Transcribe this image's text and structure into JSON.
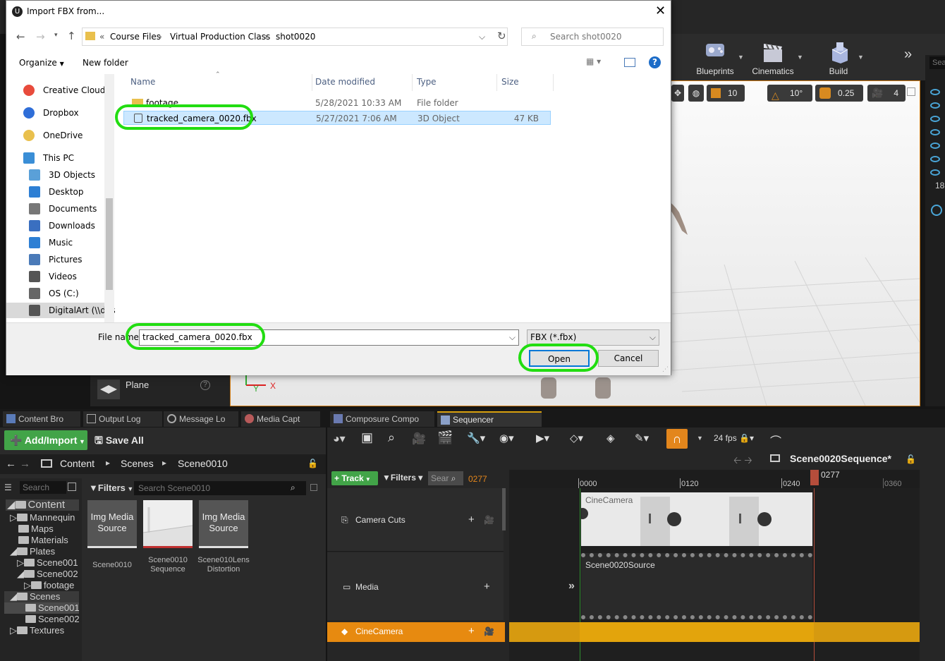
{
  "dialog": {
    "title": "Import FBX from...",
    "address": [
      "Course Files",
      "Virtual Production Class",
      "shot0020"
    ],
    "address_prefix": "«",
    "search_placeholder": "Search shot0020",
    "organize_label": "Organize",
    "new_folder_label": "New folder",
    "nav_items": [
      {
        "label": "Creative Cloud Fil",
        "icon": "creative-cloud-icon"
      },
      {
        "label": "Dropbox",
        "icon": "dropbox-icon"
      },
      {
        "label": "OneDrive",
        "icon": "onedrive-icon"
      },
      {
        "label": "This PC",
        "icon": "this-pc-icon"
      },
      {
        "label": "3D Objects",
        "icon": "3d-objects-icon"
      },
      {
        "label": "Desktop",
        "icon": "desktop-icon"
      },
      {
        "label": "Documents",
        "icon": "documents-icon"
      },
      {
        "label": "Downloads",
        "icon": "downloads-icon"
      },
      {
        "label": "Music",
        "icon": "music-icon"
      },
      {
        "label": "Pictures",
        "icon": "pictures-icon"
      },
      {
        "label": "Videos",
        "icon": "videos-icon"
      },
      {
        "label": "OS (C:)",
        "icon": "drive-icon"
      },
      {
        "label": "DigitalArt (\\\\des",
        "icon": "network-drive-icon"
      }
    ],
    "columns": [
      "Name",
      "Date modified",
      "Type",
      "Size"
    ],
    "files": [
      {
        "name": "footage",
        "date": "5/28/2021 10:33 AM",
        "type": "File folder",
        "size": ""
      },
      {
        "name": "tracked_camera_0020.fbx",
        "date": "5/27/2021 7:06 AM",
        "type": "3D Object",
        "size": "47 KB"
      }
    ],
    "file_name_label": "File name:",
    "file_name_value": "tracked_camera_0020.fbx",
    "file_type": "FBX (*.fbx)",
    "open_label": "Open",
    "cancel_label": "Cancel",
    "highlight_color": "#22dd11"
  },
  "toolbar": {
    "blueprints": "Blueprints",
    "cinematics": "Cinematics",
    "build": "Build"
  },
  "viewport_tools": {
    "grid": "10",
    "angle": "10°",
    "scale": "0.25",
    "speed": "4"
  },
  "right_strip": {
    "number": "18",
    "search": "Sea"
  },
  "plane_label": "Plane",
  "tabs": [
    "Content Bro",
    "Output Log",
    "Message Lo",
    "Media Capt",
    "Composure Compo",
    "Sequencer"
  ],
  "content_browser": {
    "add_import": "Add/Import",
    "save_all": "Save All",
    "breadcrumb": [
      "Content",
      "Scenes",
      "Scene0010"
    ],
    "search_small": "Search",
    "filters": "Filters",
    "search_placeholder": "Search Scene0010",
    "tree": [
      {
        "label": "Content",
        "depth": 0
      },
      {
        "label": "Mannequin",
        "depth": 1
      },
      {
        "label": "Maps",
        "depth": 1
      },
      {
        "label": "Materials",
        "depth": 1
      },
      {
        "label": "Plates",
        "depth": 1
      },
      {
        "label": "Scene001",
        "depth": 2
      },
      {
        "label": "Scene002",
        "depth": 2
      },
      {
        "label": "footage",
        "depth": 3
      },
      {
        "label": "Scenes",
        "depth": 1
      },
      {
        "label": "Scene001",
        "depth": 2
      },
      {
        "label": "Scene002",
        "depth": 2
      },
      {
        "label": "Textures",
        "depth": 1
      }
    ],
    "assets": [
      {
        "thumb": "Img Media Source",
        "label": "Scene0010"
      },
      {
        "thumb": "",
        "label": "Scene0010 Sequence"
      },
      {
        "thumb": "Img Media Source",
        "label": "Scene010Lens Distortion"
      }
    ]
  },
  "sequencer": {
    "fps": "24 fps",
    "sequence_name": "Scene0020Sequence*",
    "track_btn": "Track",
    "filters": "Filters",
    "search_small": "Sear",
    "current_frame": "0277",
    "ruler": [
      "0000",
      "0120",
      "0240",
      "0360"
    ],
    "playhead": "0277",
    "tracks": [
      {
        "label": "Camera Cuts",
        "icon": "camera-cuts-icon"
      },
      {
        "label": "Media",
        "icon": "media-icon"
      },
      {
        "label": "CineCamera",
        "icon": "cine-camera-icon"
      }
    ],
    "camera_clip": "CineCamera",
    "media_clip": "Scene0020Source"
  }
}
